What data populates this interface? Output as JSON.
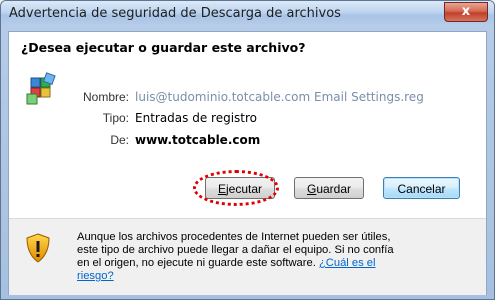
{
  "window": {
    "title": "Advertencia de seguridad de Descarga de archivos",
    "close_label": "x"
  },
  "dialog": {
    "question": "¿Desea ejecutar o guardar este archivo?",
    "fields": {
      "name_label": "Nombre:",
      "name_value": "luis@tudominio.totcable.com Email Settings.reg",
      "type_label": "Tipo:",
      "type_value": "Entradas de registro",
      "from_label": "De:",
      "from_value": "www.totcable.com"
    },
    "buttons": {
      "run_prefix": "",
      "run_accel": "E",
      "run_rest": "jecutar",
      "save_accel": "G",
      "save_rest": "uardar",
      "cancel": "Cancelar"
    },
    "warning": {
      "text": "Aunque los archivos procedentes de Internet pueden ser útiles, este tipo de archivo puede llegar a dañar el equipo. Si no confía en el origen, no ejecute ni guarde este software.",
      "link": "¿Cuál es el riesgo?"
    }
  },
  "colors": {
    "link": "#0066cc",
    "highlight_annotation": "#e00000",
    "titlebar": "#bcd3ee"
  },
  "icons": [
    "close-icon",
    "registry-file-icon",
    "security-shield-icon"
  ]
}
